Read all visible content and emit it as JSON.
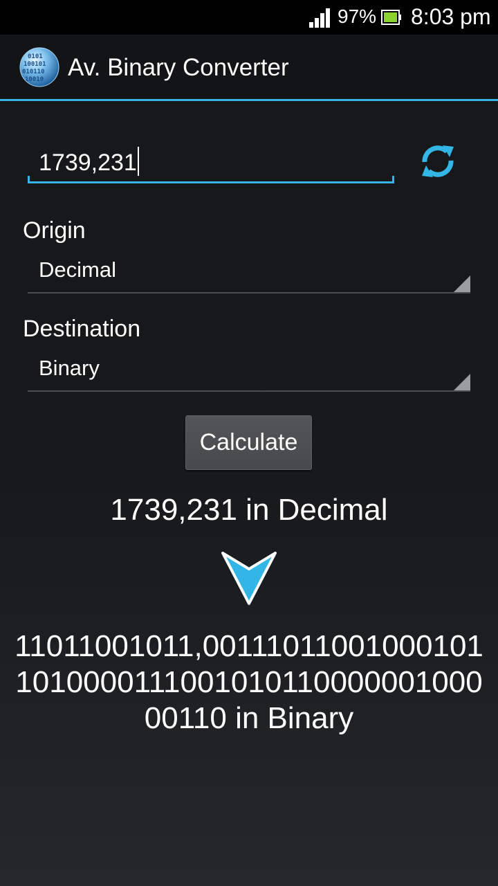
{
  "status_bar": {
    "battery_percent": "97%",
    "time": "8:03 pm",
    "signal_icon": "signal-icon",
    "battery_icon": "battery-icon"
  },
  "action_bar": {
    "title": "Av. Binary Converter",
    "logo_icon": "globe-binary-icon"
  },
  "input": {
    "value": "1739,231"
  },
  "origin": {
    "label": "Origin",
    "selected": "Decimal"
  },
  "destination": {
    "label": "Destination",
    "selected": "Binary"
  },
  "calculate_label": "Calculate",
  "result": {
    "origin_text": "1739,231 in Decimal",
    "destination_text": "11011001011,00111011001000101101000011100101011000000100000110 in Binary"
  },
  "colors": {
    "accent": "#33b5e5",
    "background": "#17191b",
    "button": "#4e5052"
  }
}
